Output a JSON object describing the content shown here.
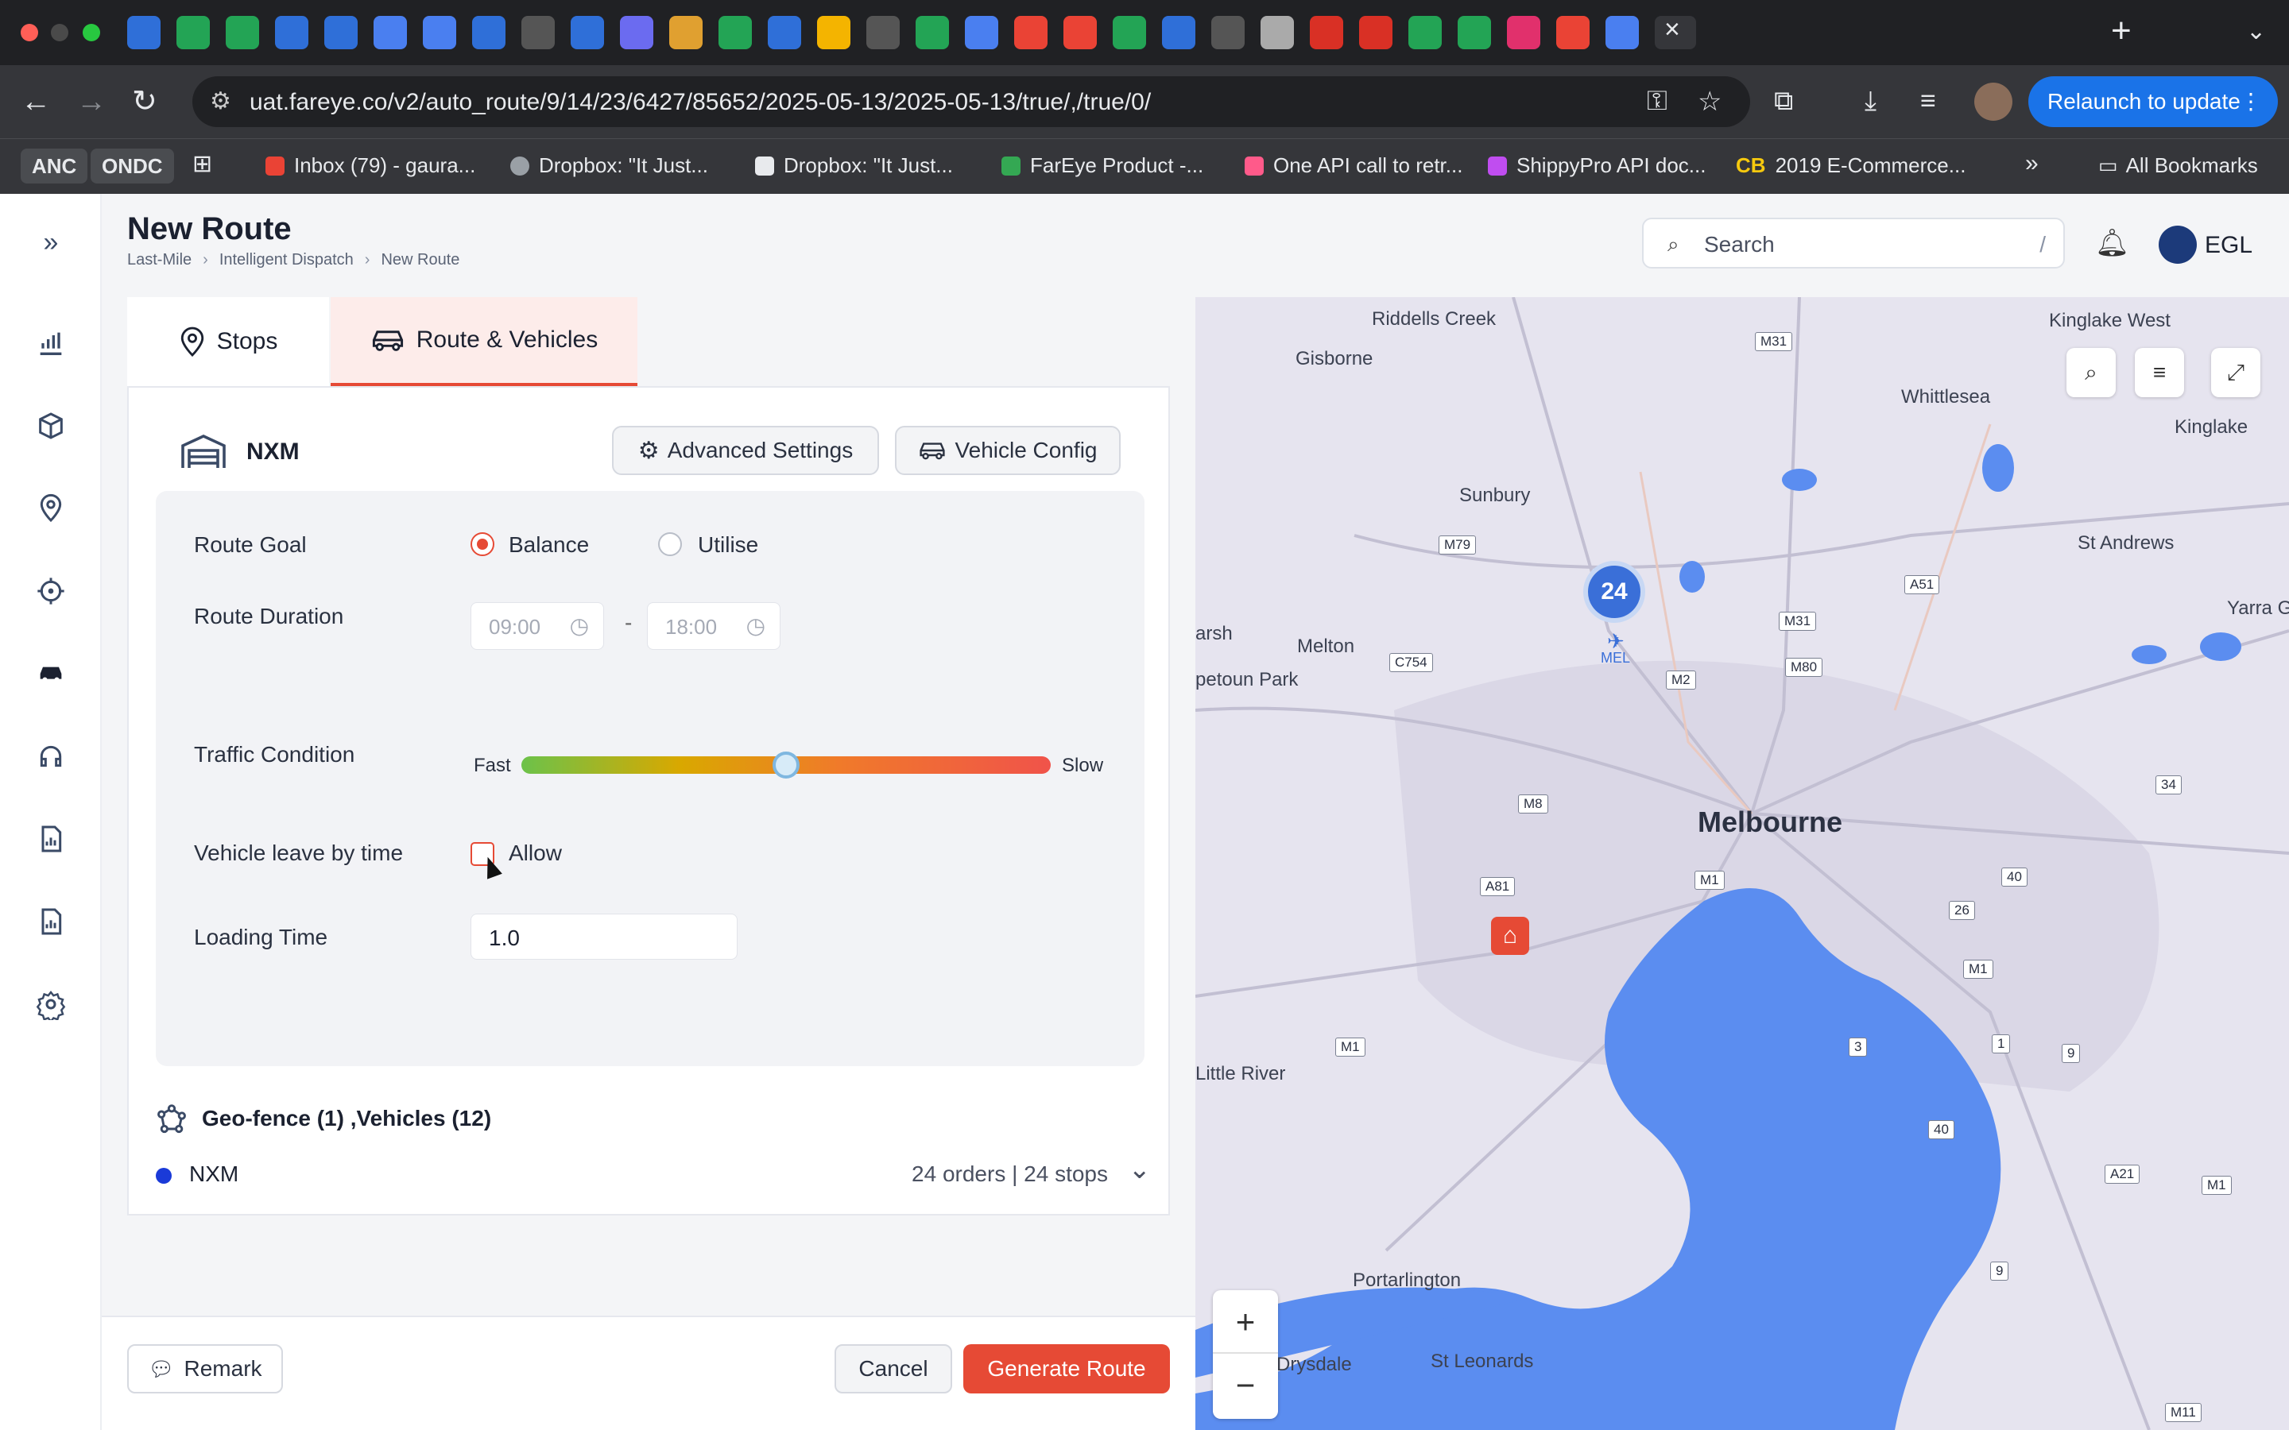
{
  "browser": {
    "url": "uat.fareye.co/v2/auto_route/9/14/23/6427/85652/2025-05-13/2025-05-13/true/,/true/0/",
    "relaunch_label": "Relaunch to update",
    "bookmarks": [
      {
        "label": "ANC",
        "type": "badge"
      },
      {
        "label": "ONDC",
        "type": "badge"
      },
      {
        "label": "Inbox (79) - gaura...",
        "color": "#ea4335"
      },
      {
        "label": "Dropbox: \"It Just...",
        "color": "#9aa0a6"
      },
      {
        "label": "Dropbox: \"It Just...",
        "color": "#e8eaed"
      },
      {
        "label": "FarEye Product -...",
        "color": "#34a853"
      },
      {
        "label": "One API call to retr...",
        "color": "#ff5a8a"
      },
      {
        "label": "ShippyPro API doc...",
        "color": "#c04df0"
      },
      {
        "label": "2019 E-Commerce...",
        "color": "#f6c90e"
      }
    ],
    "all_bookmarks_label": "All Bookmarks",
    "cb_label": "CB"
  },
  "header": {
    "title": "New Route",
    "breadcrumb": [
      "Last-Mile",
      "Intelligent Dispatch",
      "New Route"
    ],
    "search_placeholder": "Search",
    "search_shortcut": "/",
    "user_name": "EGL"
  },
  "tabs": {
    "stops": "Stops",
    "route_vehicles": "Route & Vehicles"
  },
  "hub": {
    "name": "NXM",
    "advanced_settings": "Advanced Settings",
    "vehicle_config": "Vehicle Config"
  },
  "config": {
    "route_goal_label": "Route Goal",
    "goal_options": [
      "Balance",
      "Utilise"
    ],
    "goal_selected": "Balance",
    "route_duration_label": "Route Duration",
    "start_time": "09:00",
    "end_time": "18:00",
    "time_separator": "-",
    "traffic_label": "Traffic Condition",
    "traffic_min": "Fast",
    "traffic_max": "Slow",
    "traffic_level": 0.5,
    "leave_label": "Vehicle leave by time",
    "allow_label": "Allow",
    "allow_checked": false,
    "loading_label": "Loading Time",
    "loading_value": "1.0"
  },
  "summary": {
    "geo_title": "Geo-fence (1) ,Vehicles (12)",
    "vehicle_name": "NXM",
    "vehicle_color": "#1a3ad8",
    "vehicle_stats": "24 orders | 24 stops"
  },
  "footer": {
    "remark": "Remark",
    "cancel": "Cancel",
    "generate": "Generate Route"
  },
  "map": {
    "cluster_count": "24",
    "labels": {
      "riddells": "Riddells Creek",
      "gisborne": "Gisborne",
      "sunbury": "Sunbury",
      "whittlesea": "Whittlesea",
      "kinglake_west": "Kinglake West",
      "kinglake": "Kinglake",
      "st_andrews": "St Andrews",
      "yarra": "Yarra Gler",
      "melton": "Melton",
      "arsh": "arsh",
      "petoun": "petoun Park",
      "mel": "MEL",
      "melbourne": "Melbourne",
      "little_river": "Little River",
      "portarlington": "Portarlington",
      "drysdale": "Drysdale",
      "st_leonards": "St Leonards"
    },
    "shields": [
      "M31",
      "M79",
      "A51",
      "M31",
      "M80",
      "C754",
      "M2",
      "M8",
      "M1",
      "A81",
      "40",
      "26",
      "M1",
      "34",
      "M1",
      "3",
      "1",
      "9",
      "40",
      "A21",
      "M1",
      "9",
      "M11"
    ],
    "zoom_in": "+",
    "zoom_out": "−"
  },
  "colors": {
    "accent": "#e64a35",
    "water": "#5b8df0",
    "land": "#e6e4ef"
  }
}
